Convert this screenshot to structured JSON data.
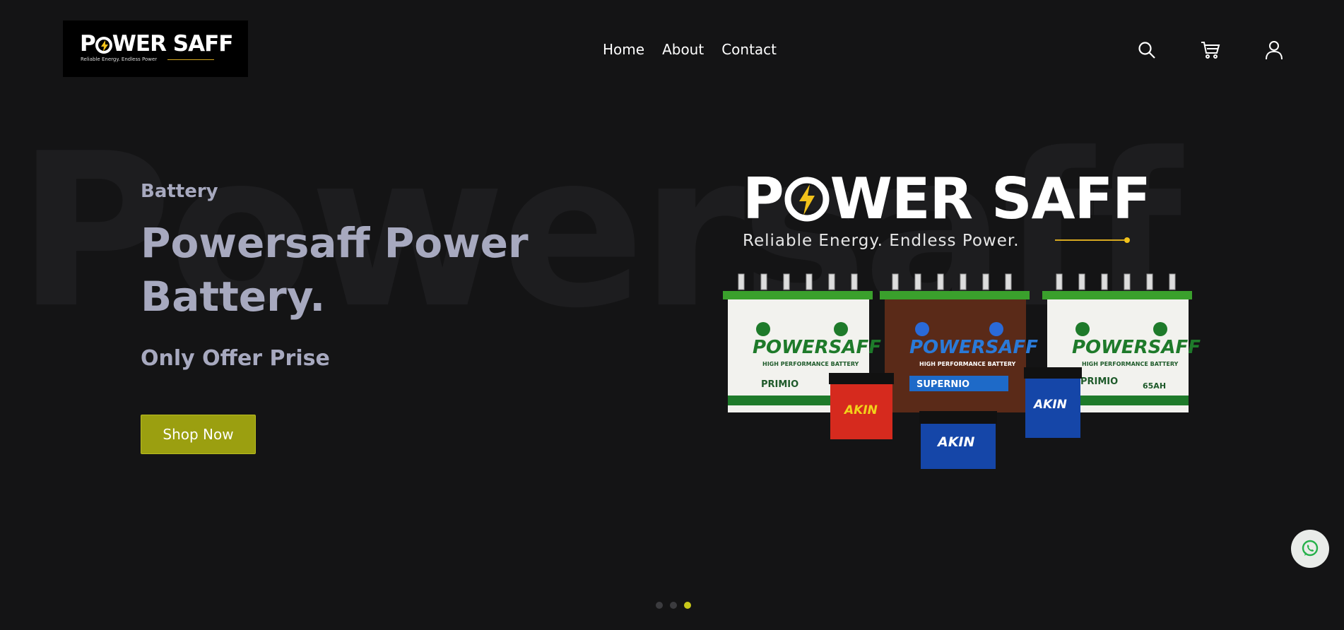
{
  "header": {
    "logo": {
      "name": "POWER SAFF",
      "tagline": "Reliable Energy. Endless Power"
    },
    "nav": [
      {
        "label": "Home"
      },
      {
        "label": "About"
      },
      {
        "label": "Contact"
      }
    ],
    "icons": [
      "search-icon",
      "cart-icon",
      "user-icon"
    ]
  },
  "hero": {
    "watermark": "Powersaff",
    "subtitle": "Battery",
    "title": "Powersaff Power Battery.",
    "offer": "Only Offer Prise",
    "cta": "Shop Now",
    "banner": {
      "brand": "POWER SAFF",
      "tagline": "Reliable Energy. Endless Power.",
      "batteries": [
        {
          "brand": "POWERSAFF",
          "line": "HIGH PERFORMANCE BATTERY",
          "model": "PRIMIO",
          "color": "#f2f2ee"
        },
        {
          "brand": "POWERSAFF",
          "line": "HIGH PERFORMANCE BATTERY",
          "model": "SUPERNIO",
          "color": "#5a2a18"
        },
        {
          "brand": "POWERSAFF",
          "line": "HIGH PERFORMANCE BATTERY",
          "model": "PRIMIO",
          "capacity": "65AH",
          "color": "#f2f2ee"
        },
        {
          "brand": "AKIN",
          "color": "#d62a1e"
        },
        {
          "brand": "AKIN",
          "color": "#1546a8"
        },
        {
          "brand": "AKIN",
          "color": "#1546a8"
        }
      ]
    }
  },
  "slider": {
    "count": 3,
    "active": 3
  },
  "colors": {
    "background": "#141415",
    "accent": "#9b9f10",
    "text_muted": "#a7a9bf",
    "dot_active": "#c8c81a"
  },
  "floating": {
    "icon": "whatsapp-icon"
  }
}
